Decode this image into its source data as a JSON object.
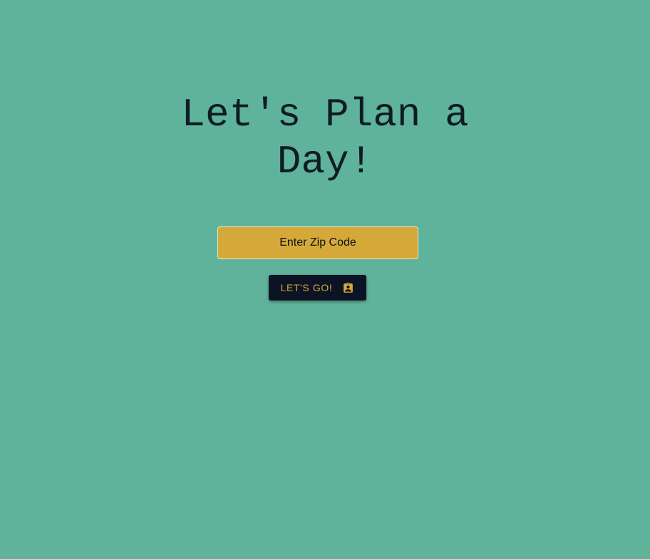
{
  "page": {
    "title_line1": "Let's Plan a",
    "title_line2": "Day!"
  },
  "zip_input": {
    "placeholder": "Enter Zip Code",
    "value": ""
  },
  "go_button": {
    "label": "LET'S GO!",
    "icon": "contact-card-icon"
  },
  "colors": {
    "background": "#5fb39b",
    "input_background": "#d4a93a",
    "button_background": "#0c1324",
    "button_text": "#d4a93a",
    "title_text": "#0f1c24"
  }
}
